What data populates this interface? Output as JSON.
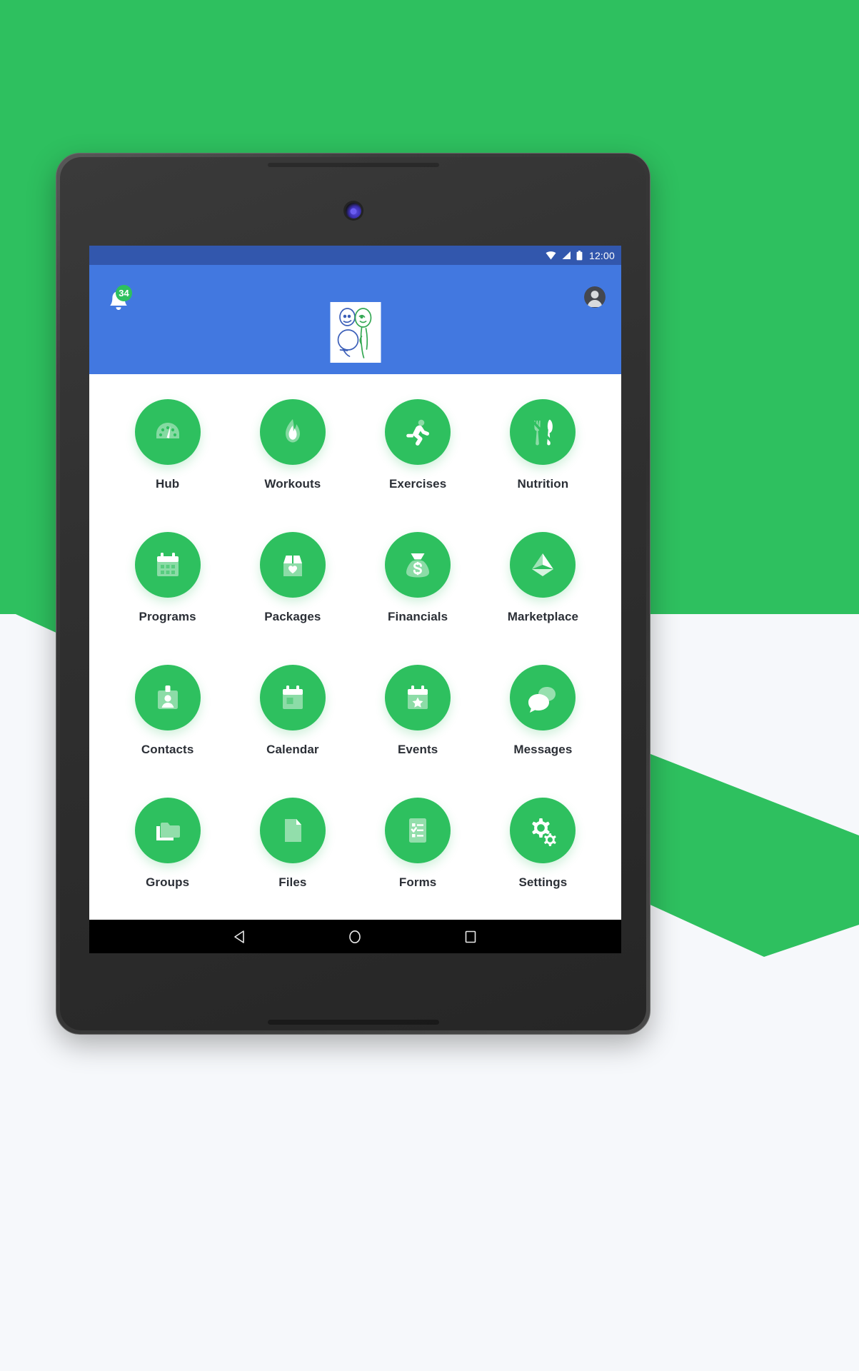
{
  "background": {
    "accent_green": "#2ec05f",
    "page_bg": "#f6f8fb"
  },
  "device": {
    "name": "android-tablet",
    "frame_color": "#3c3c3c"
  },
  "statusbar": {
    "time": "12:00",
    "background": "#3257ad",
    "icons": [
      "wifi-icon",
      "signal-icon",
      "battery-icon"
    ]
  },
  "appbar": {
    "background": "#4278e0",
    "notification": {
      "icon": "bell-icon",
      "badge_count": "34",
      "badge_color": "#2ec05f"
    },
    "avatar": {
      "icon": "user-avatar-icon"
    },
    "logo": {
      "name": "app-logo",
      "description": "two stick figures drawing, blue and green"
    }
  },
  "grid": {
    "icon_color": "#2ec05f",
    "items": [
      {
        "label": "Hub",
        "icon": "speedometer-icon"
      },
      {
        "label": "Workouts",
        "icon": "flame-icon"
      },
      {
        "label": "Exercises",
        "icon": "running-person-icon"
      },
      {
        "label": "Nutrition",
        "icon": "fork-knife-icon"
      },
      {
        "label": "Programs",
        "icon": "calendar-icon"
      },
      {
        "label": "Packages",
        "icon": "box-heart-icon"
      },
      {
        "label": "Financials",
        "icon": "money-bag-icon"
      },
      {
        "label": "Marketplace",
        "icon": "send-arrow-icon"
      },
      {
        "label": "Contacts",
        "icon": "id-badge-icon"
      },
      {
        "label": "Calendar",
        "icon": "calendar-day-icon"
      },
      {
        "label": "Events",
        "icon": "calendar-star-icon"
      },
      {
        "label": "Messages",
        "icon": "chat-bubbles-icon"
      },
      {
        "label": "Groups",
        "icon": "folders-icon"
      },
      {
        "label": "Files",
        "icon": "document-icon"
      },
      {
        "label": "Forms",
        "icon": "checklist-icon"
      },
      {
        "label": "Settings",
        "icon": "gears-icon"
      }
    ]
  },
  "navbar": {
    "background": "#000000",
    "buttons": [
      {
        "name": "back-button",
        "icon": "triangle-back-icon"
      },
      {
        "name": "home-button",
        "icon": "circle-home-icon"
      },
      {
        "name": "recents-button",
        "icon": "square-recents-icon"
      }
    ]
  }
}
